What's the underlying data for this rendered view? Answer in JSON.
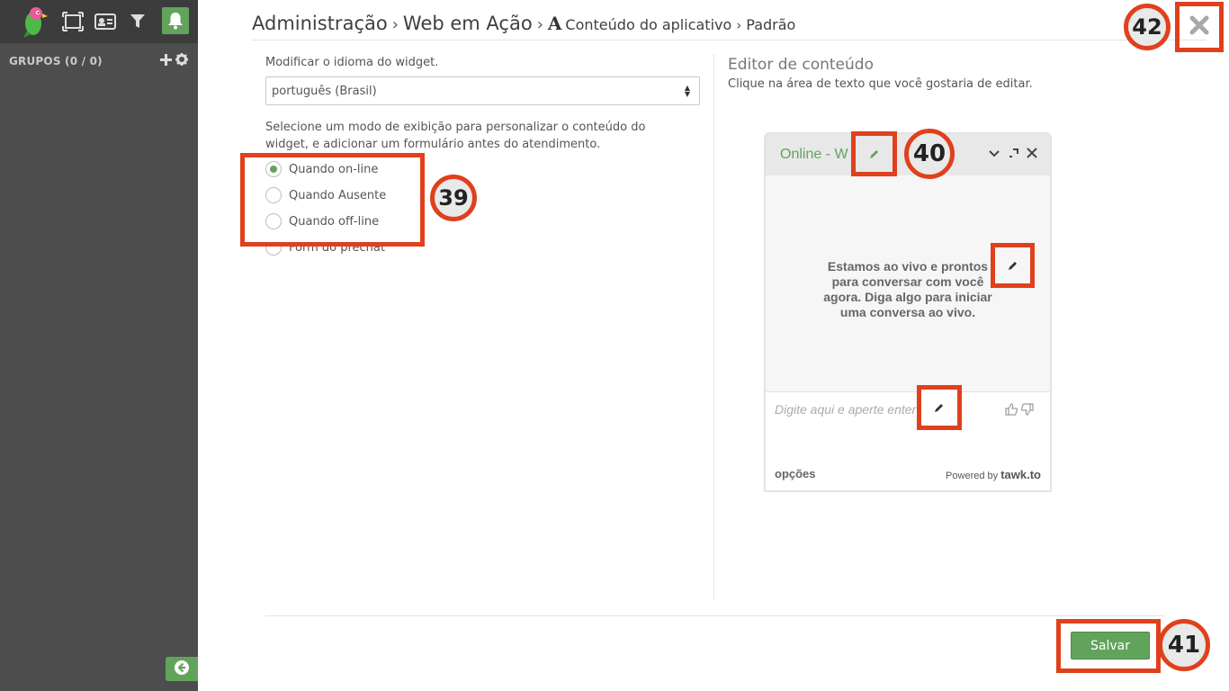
{
  "sidebar": {
    "groups_label": "GRUPOS (0 / 0)",
    "bell_color": "#62a35c"
  },
  "breadcrumb": {
    "part1": "Administração",
    "part2": "Web em Ação",
    "glyph": "A",
    "part3": "Conteúdo do aplicativo",
    "part4": "Padrão",
    "sep": "›"
  },
  "form": {
    "language_label": "Modificar o idioma do widget.",
    "language_value": "português (Brasil)",
    "mode_description": "Selecione um modo de exibição para personalizar o conteúdo do widget, e adicionar um formulário antes do atendimento.",
    "modes": [
      {
        "label": "Quando on-line",
        "selected": true
      },
      {
        "label": "Quando Ausente",
        "selected": false
      },
      {
        "label": "Quando off-line",
        "selected": false
      },
      {
        "label": "Form do prechat",
        "selected": false
      }
    ]
  },
  "editor": {
    "title": "Editor de conteúdo",
    "subtitle": "Clique na área de texto que você gostaria de editar."
  },
  "widget": {
    "status": "Online - W",
    "message": "Estamos ao vivo e prontos para conversar com você agora. Diga algo para iniciar uma conversa ao vivo.",
    "placeholder": "Digite aqui e aperte enter",
    "options_label": "opções",
    "powered_by": "Powered by",
    "brand": "tawk.to"
  },
  "actions": {
    "save_label": "Salvar"
  },
  "annotations": {
    "badge_39": "39",
    "badge_40": "40",
    "badge_41": "41",
    "badge_42": "42",
    "highlight_color": "#e0401c"
  },
  "colors": {
    "accent": "#62a35c",
    "sidebar": "#4d4d4d",
    "topbar": "#3c3c3c"
  }
}
